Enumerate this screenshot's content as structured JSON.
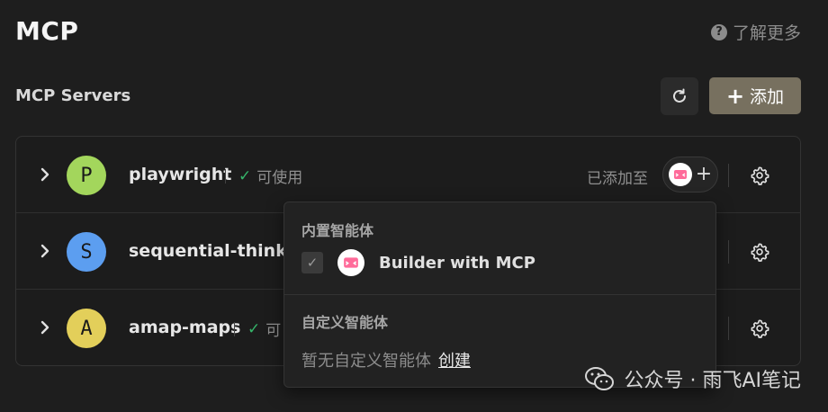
{
  "header": {
    "title": "MCP",
    "learn_more": "了解更多",
    "help_icon": "?"
  },
  "section": {
    "title": "MCP Servers",
    "refresh_icon": "refresh-icon",
    "add_label": "添加",
    "add_icon": "+"
  },
  "servers": [
    {
      "avatar": "P",
      "avatar_color": "#a3d65c",
      "name": "playwright",
      "status": "可使用",
      "added_to": "已添加至"
    },
    {
      "avatar": "S",
      "avatar_color": "#5c9ef0",
      "name": "sequential-thinking"
    },
    {
      "avatar": "A",
      "avatar_color": "#e3cf5a",
      "name": "amap-maps",
      "status": "可"
    }
  ],
  "dropdown": {
    "builtin_heading": "内置智能体",
    "builtin_items": [
      {
        "label": "Builder with MCP",
        "checked": true
      }
    ],
    "custom_heading": "自定义智能体",
    "custom_empty": "暂无自定义智能体",
    "custom_create": "创建"
  },
  "watermark": {
    "text": "公众号 · 雨飞AI笔记"
  },
  "colors": {
    "accent_button": "#77705f",
    "status_ok": "#35b56a",
    "background": "#1e1e1e"
  }
}
